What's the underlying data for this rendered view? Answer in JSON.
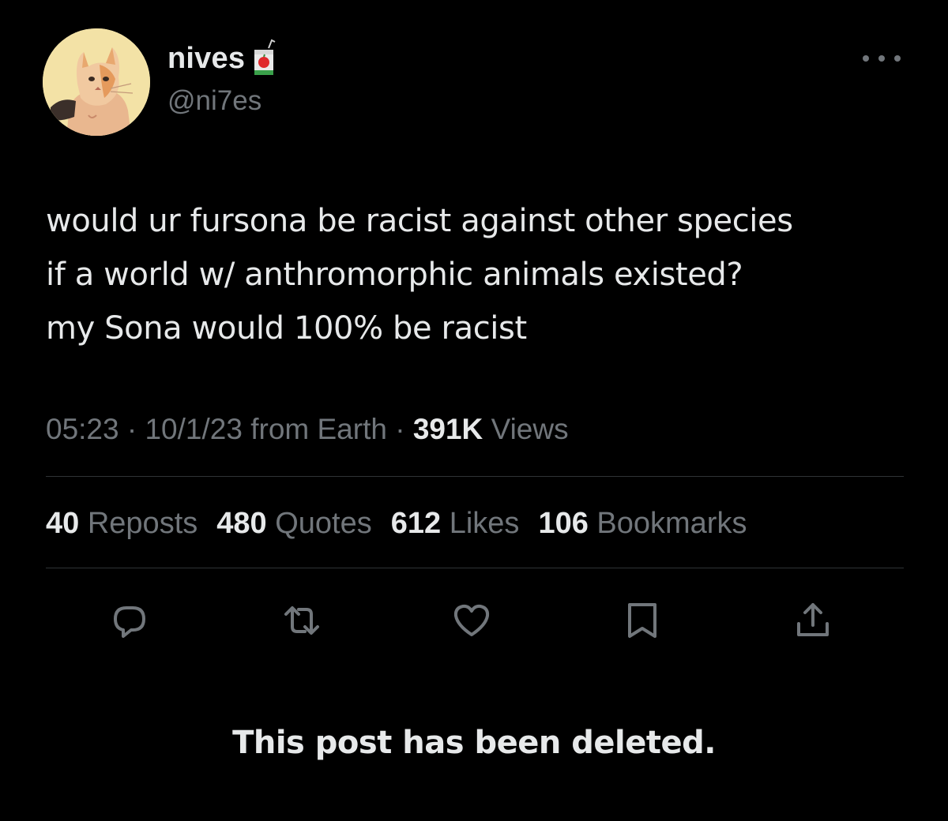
{
  "author": {
    "display_name": "nives",
    "handle": "@ni7es",
    "name_emoji": "juice-box-icon",
    "avatar": "cat-fursona-avatar"
  },
  "post": {
    "lines": [
      "would ur fursona be racist against other species",
      "if a world w/ anthromorphic animals existed?",
      "my Sona would 100% be racist"
    ]
  },
  "meta": {
    "time": "05:23",
    "separator": " · ",
    "date_location": "10/1/23 from Earth",
    "views_count": "391K",
    "views_label": "Views"
  },
  "stats": [
    {
      "count": "40",
      "label": "Reposts"
    },
    {
      "count": "480",
      "label": "Quotes"
    },
    {
      "count": "612",
      "label": "Likes"
    },
    {
      "count": "106",
      "label": "Bookmarks"
    }
  ],
  "actions": [
    "reply-icon",
    "repost-icon",
    "like-icon",
    "bookmark-icon",
    "share-icon"
  ],
  "deleted_notice": "This post has been deleted.",
  "colors": {
    "background": "#000000",
    "primary_text": "#e7e9ea",
    "secondary_text": "#71767b",
    "divider": "#2f3336"
  }
}
